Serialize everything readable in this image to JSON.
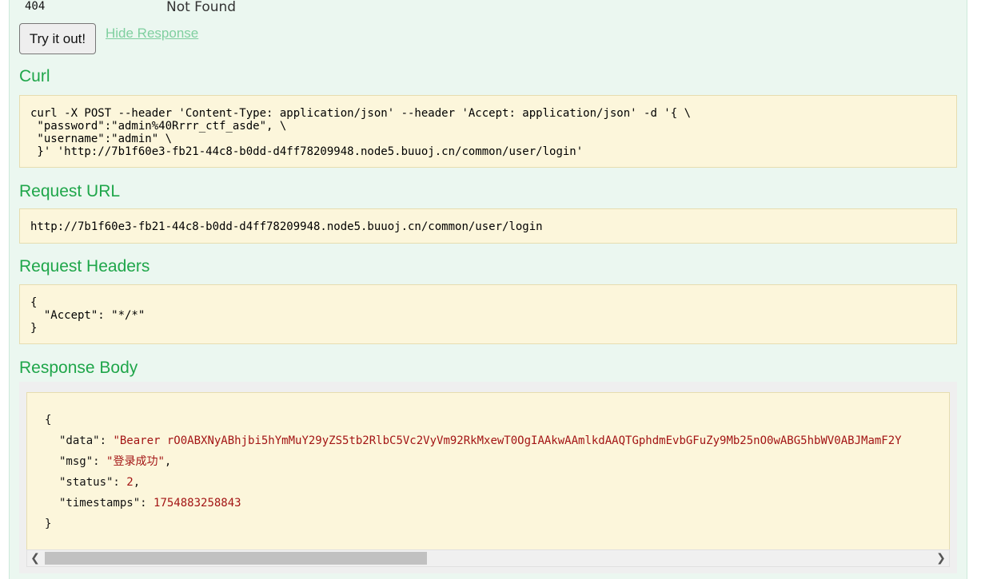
{
  "status": {
    "code": "404",
    "message": "Not Found"
  },
  "actions": {
    "try_label": "Try it out!",
    "hide_label": "Hide Response"
  },
  "curl": {
    "title": "Curl",
    "command": "curl -X POST --header 'Content-Type: application/json' --header 'Accept: application/json' -d '{ \\\n \"password\":\"admin%40Rrrr_ctf_asde\", \\\n \"username\":\"admin\" \\\n }' 'http://7b1f60e3-fb21-44c8-b0dd-d4ff78209948.node5.buuoj.cn/common/user/login'"
  },
  "request_url": {
    "title": "Request URL",
    "value": "http://7b1f60e3-fb21-44c8-b0dd-d4ff78209948.node5.buuoj.cn/common/user/login"
  },
  "request_headers": {
    "title": "Request Headers",
    "value": "{\n  \"Accept\": \"*/*\"\n}"
  },
  "response_body": {
    "title": "Response Body",
    "open_brace": "{",
    "close_brace": "}",
    "data_key": "\"data\": ",
    "data_value": "\"Bearer rO0ABXNyABhjbi5hYmMuY29yZS5tb2RlbC5Vc2VyVm92RkMxewT0OgIAAkwAAmlkdAAQTGphdmEvbGFuZy9Mb25nO0wABG5hbWV0ABJMamF2Y",
    "msg_key": "\"msg\": ",
    "msg_value": "\"登录成功\"",
    "status_key": "\"status\": ",
    "status_value": "2",
    "timestamps_key": "\"timestamps\": ",
    "timestamps_value": "1754883258843"
  },
  "scrollbar": {
    "position": 0.0,
    "thumb_fraction": 0.42
  }
}
